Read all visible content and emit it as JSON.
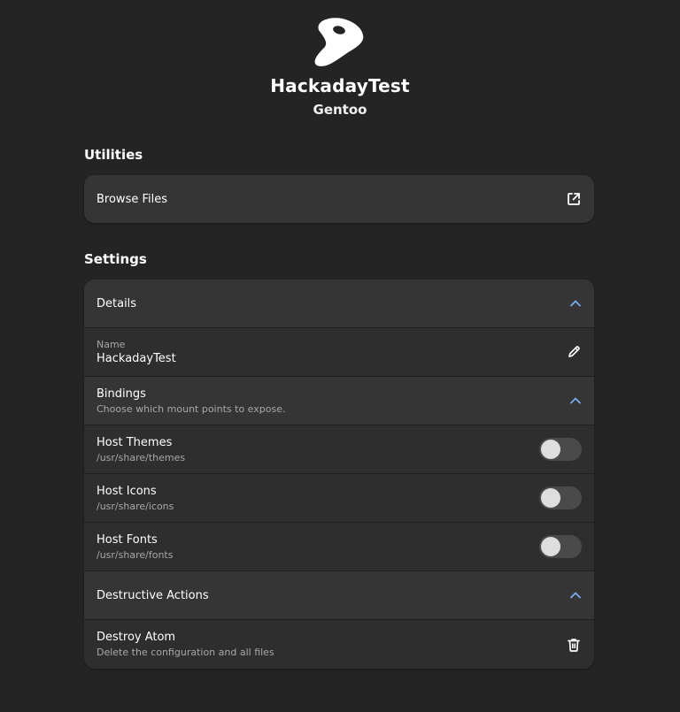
{
  "app": {
    "title": "HackadayTest",
    "subtitle": "Gentoo",
    "logo_icon": "gentoo-logo"
  },
  "utilities": {
    "heading": "Utilities",
    "browse_files": {
      "label": "Browse Files",
      "icon": "external-link-icon"
    }
  },
  "settings": {
    "heading": "Settings",
    "details": {
      "label": "Details",
      "expanded": true,
      "name_label": "Name",
      "name_value": "HackadayTest",
      "edit_icon": "pencil-icon"
    },
    "bindings": {
      "label": "Bindings",
      "description": "Choose which mount points to expose.",
      "expanded": true,
      "items": [
        {
          "title": "Host Themes",
          "path": "/usr/share/themes",
          "enabled": false
        },
        {
          "title": "Host Icons",
          "path": "/usr/share/icons",
          "enabled": false
        },
        {
          "title": "Host Fonts",
          "path": "/usr/share/fonts",
          "enabled": false
        }
      ]
    },
    "destructive": {
      "label": "Destructive Actions",
      "expanded": true,
      "destroy_title": "Destroy Atom",
      "destroy_description": "Delete the configuration and all files",
      "destroy_icon": "trash-icon"
    }
  },
  "colors": {
    "background": "#242424",
    "card": "#2e2e2e",
    "expander_row": "#353535",
    "accent": "#78aeed"
  }
}
